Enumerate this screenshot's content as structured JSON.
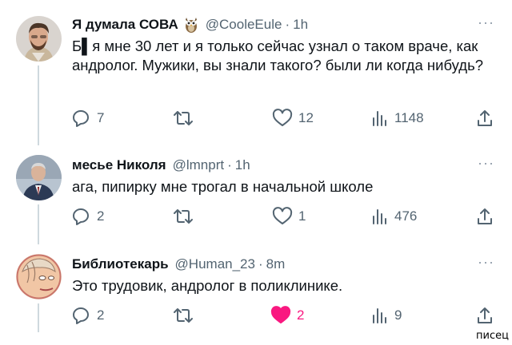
{
  "tweets": [
    {
      "name": "Я думала СОВА",
      "emoji": "owl-emoji",
      "handle": "@CooleEule",
      "dot": "·",
      "time": "1h",
      "text": "Б▌я мне 30 лет и я только сейчас узнал о таком враче, как андролог. Мужики, вы знали такого? были ли когда нибудь?",
      "replies": "7",
      "retweets": "",
      "likes": "12",
      "views": "1148",
      "liked": false
    },
    {
      "name": "месье Николя",
      "handle": "@lmnprt",
      "dot": "·",
      "time": "1h",
      "text": "ага, пипирку мне трогал в начальной школе",
      "replies": "2",
      "retweets": "",
      "likes": "1",
      "views": "476",
      "liked": false
    },
    {
      "name": "Библиотекарь",
      "handle": "@Human_23",
      "dot": "·",
      "time": "8m",
      "text": "Это трудовик, андролог в поликлинике.",
      "replies": "2",
      "retweets": "",
      "likes": "2",
      "views": "9",
      "liked": true
    }
  ],
  "more_label": "···",
  "watermark": "писец",
  "colors": {
    "text": "#0f1419",
    "muted": "#536471",
    "like": "#f91880",
    "line": "#cfd9de"
  }
}
